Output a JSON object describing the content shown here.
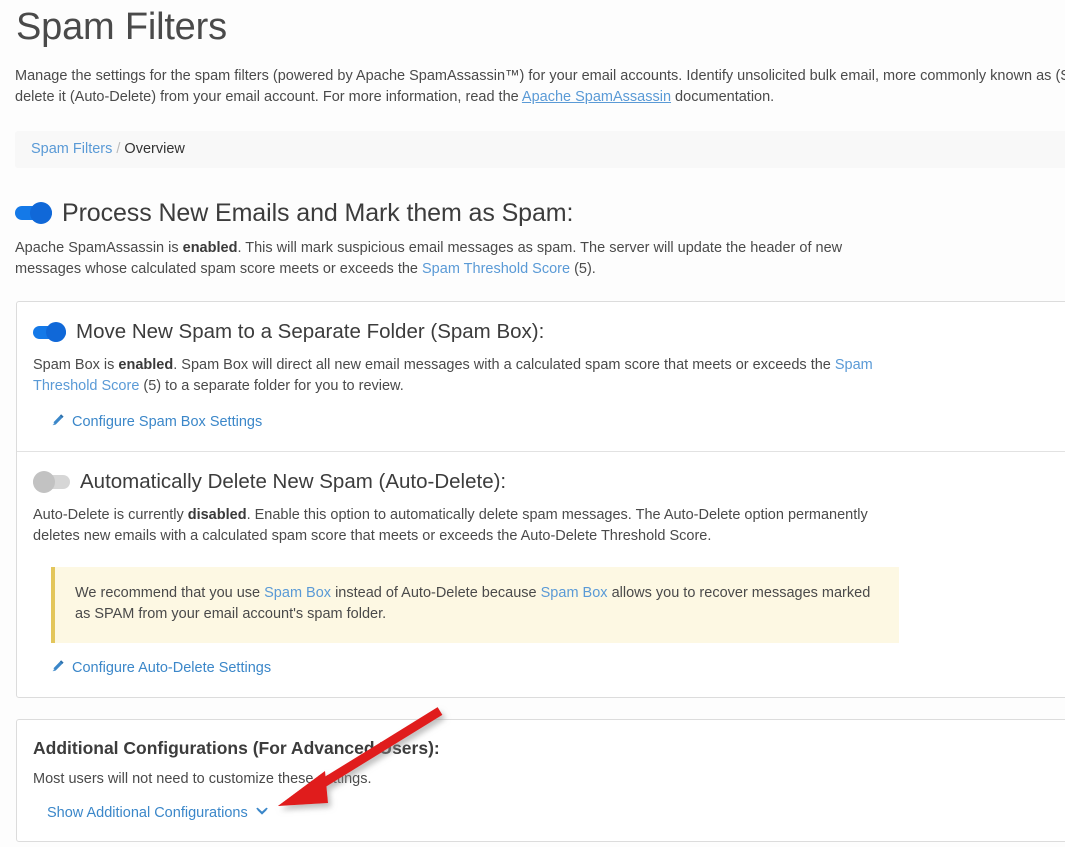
{
  "header": {
    "title": "Spam Filters",
    "description_part1": "Manage the settings for the spam filters (powered by Apache SpamAssassin™) for your email accounts. Identify unsolicited bulk email, more commonly known as ",
    "description_part2": "(Spam Box) or automatically delete it (Auto-Delete) from your email account. For more information, read the ",
    "doc_link_label": "Apache SpamAssassin",
    "description_part3": " documentation."
  },
  "breadcrumb": {
    "root_label": "Spam Filters",
    "separator": "/",
    "current_label": "Overview"
  },
  "process_spam": {
    "heading": "Process New Emails and Mark them as Spam:",
    "toggle_state": "on",
    "desc_pre": "Apache SpamAssassin is ",
    "desc_state": "enabled",
    "desc_mid": ". This will mark suspicious email messages as spam. The server will update the header of new messages whose calculated spam score meets or exceeds the ",
    "threshold_link_label": "Spam Threshold Score",
    "desc_post": " (5)."
  },
  "spam_box": {
    "heading": "Move New Spam to a Separate Folder (Spam Box):",
    "toggle_state": "on",
    "desc_pre": "Spam Box is ",
    "desc_state": "enabled",
    "desc_mid": ". Spam Box will direct all new email messages with a calculated spam score that meets or exceeds the ",
    "threshold_link_label": "Spam Threshold Score",
    "desc_post": " (5) to a separate folder for you to review.",
    "configure_link_label": "Configure Spam Box Settings",
    "configure_icon": "pencil-icon"
  },
  "auto_delete": {
    "heading": "Automatically Delete New Spam (Auto-Delete):",
    "toggle_state": "off",
    "desc_pre": "Auto-Delete is currently ",
    "desc_state": "disabled",
    "desc_post": ". Enable this option to automatically delete spam messages. The Auto-Delete option permanently deletes new emails with a calculated spam score that meets or exceeds the Auto-Delete Threshold Score.",
    "callout": {
      "pre": "We recommend that you use ",
      "link1_label": "Spam Box",
      "mid": " instead of Auto-Delete because ",
      "link2_label": "Spam Box",
      "post": " allows you to recover messages marked as SPAM from your email account's spam folder."
    },
    "configure_link_label": "Configure Auto-Delete Settings",
    "configure_icon": "pencil-icon"
  },
  "additional_configs": {
    "heading": "Additional Configurations (For Advanced Users):",
    "description": "Most users will not need to customize these settings.",
    "show_link_label": "Show Additional Configurations",
    "chevron_icon": "chevron-down-icon"
  },
  "annotation": {
    "type": "arrow",
    "color": "#e01b1b",
    "points_to": "show-additional-configurations-link"
  },
  "colors": {
    "accent_link": "#5a9ad6",
    "toggle_on": "#1479e8",
    "toggle_off": "#c2c2c2",
    "callout_bg": "#fdf8e3",
    "callout_border": "#e3c65b",
    "card_border": "#dcdcdc",
    "annotation_red": "#e01b1b"
  }
}
